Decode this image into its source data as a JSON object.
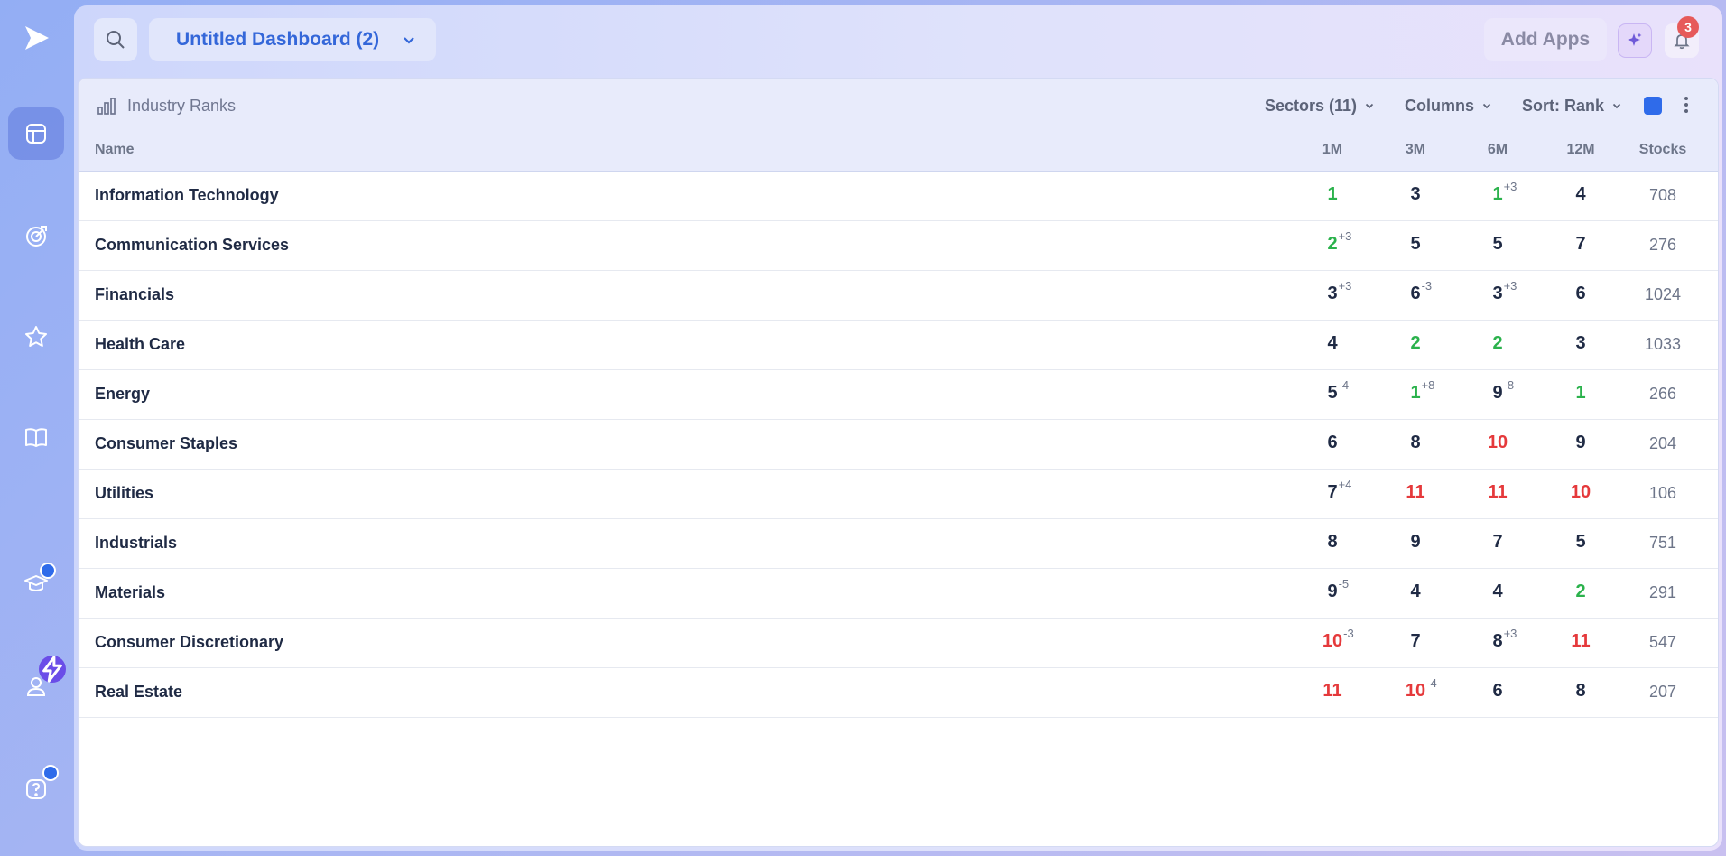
{
  "topbar": {
    "dashboard_title": "Untitled Dashboard (2)",
    "add_apps_label": "Add Apps",
    "notification_count": "3"
  },
  "widget": {
    "title": "Industry Ranks",
    "sectors_label": "Sectors (11)",
    "columns_label": "Columns",
    "sort_label": "Sort: Rank",
    "color_swatch": "#2f6bea"
  },
  "table": {
    "headers": {
      "name": "Name",
      "m1": "1M",
      "m3": "3M",
      "m6": "6M",
      "m12": "12M",
      "stocks": "Stocks"
    },
    "rows": [
      {
        "name": "Information Technology",
        "m1": {
          "v": "1",
          "d": "",
          "c": "green"
        },
        "m3": {
          "v": "3",
          "d": "",
          "c": ""
        },
        "m6": {
          "v": "1",
          "d": "+3",
          "c": "green"
        },
        "m12": {
          "v": "4",
          "d": "",
          "c": ""
        },
        "stocks": "708"
      },
      {
        "name": "Communication Services",
        "m1": {
          "v": "2",
          "d": "+3",
          "c": "green"
        },
        "m3": {
          "v": "5",
          "d": "",
          "c": ""
        },
        "m6": {
          "v": "5",
          "d": "",
          "c": ""
        },
        "m12": {
          "v": "7",
          "d": "",
          "c": ""
        },
        "stocks": "276"
      },
      {
        "name": "Financials",
        "m1": {
          "v": "3",
          "d": "+3",
          "c": ""
        },
        "m3": {
          "v": "6",
          "d": "-3",
          "c": ""
        },
        "m6": {
          "v": "3",
          "d": "+3",
          "c": ""
        },
        "m12": {
          "v": "6",
          "d": "",
          "c": ""
        },
        "stocks": "1024"
      },
      {
        "name": "Health Care",
        "m1": {
          "v": "4",
          "d": "",
          "c": ""
        },
        "m3": {
          "v": "2",
          "d": "",
          "c": "green"
        },
        "m6": {
          "v": "2",
          "d": "",
          "c": "green"
        },
        "m12": {
          "v": "3",
          "d": "",
          "c": ""
        },
        "stocks": "1033"
      },
      {
        "name": "Energy",
        "m1": {
          "v": "5",
          "d": "-4",
          "c": ""
        },
        "m3": {
          "v": "1",
          "d": "+8",
          "c": "green"
        },
        "m6": {
          "v": "9",
          "d": "-8",
          "c": ""
        },
        "m12": {
          "v": "1",
          "d": "",
          "c": "green"
        },
        "stocks": "266"
      },
      {
        "name": "Consumer Staples",
        "m1": {
          "v": "6",
          "d": "",
          "c": ""
        },
        "m3": {
          "v": "8",
          "d": "",
          "c": ""
        },
        "m6": {
          "v": "10",
          "d": "",
          "c": "red"
        },
        "m12": {
          "v": "9",
          "d": "",
          "c": ""
        },
        "stocks": "204"
      },
      {
        "name": "Utilities",
        "m1": {
          "v": "7",
          "d": "+4",
          "c": ""
        },
        "m3": {
          "v": "11",
          "d": "",
          "c": "red"
        },
        "m6": {
          "v": "11",
          "d": "",
          "c": "red"
        },
        "m12": {
          "v": "10",
          "d": "",
          "c": "red"
        },
        "stocks": "106"
      },
      {
        "name": "Industrials",
        "m1": {
          "v": "8",
          "d": "",
          "c": ""
        },
        "m3": {
          "v": "9",
          "d": "",
          "c": ""
        },
        "m6": {
          "v": "7",
          "d": "",
          "c": ""
        },
        "m12": {
          "v": "5",
          "d": "",
          "c": ""
        },
        "stocks": "751"
      },
      {
        "name": "Materials",
        "m1": {
          "v": "9",
          "d": "-5",
          "c": ""
        },
        "m3": {
          "v": "4",
          "d": "",
          "c": ""
        },
        "m6": {
          "v": "4",
          "d": "",
          "c": ""
        },
        "m12": {
          "v": "2",
          "d": "",
          "c": "green"
        },
        "stocks": "291"
      },
      {
        "name": "Consumer Discretionary",
        "m1": {
          "v": "10",
          "d": "-3",
          "c": "red"
        },
        "m3": {
          "v": "7",
          "d": "",
          "c": ""
        },
        "m6": {
          "v": "8",
          "d": "+3",
          "c": ""
        },
        "m12": {
          "v": "11",
          "d": "",
          "c": "red"
        },
        "stocks": "547"
      },
      {
        "name": "Real Estate",
        "m1": {
          "v": "11",
          "d": "",
          "c": "red"
        },
        "m3": {
          "v": "10",
          "d": "-4",
          "c": "red"
        },
        "m6": {
          "v": "6",
          "d": "",
          "c": ""
        },
        "m12": {
          "v": "8",
          "d": "",
          "c": ""
        },
        "stocks": "207"
      }
    ]
  },
  "colors": {
    "green": "#2bb24c",
    "red": "#e5393b",
    "accent": "#3467d9"
  },
  "icons": {
    "sidebar": [
      "logo-icon",
      "dashboard-icon",
      "radar-icon",
      "star-icon",
      "book-icon",
      "graduation-cap-icon",
      "user-icon",
      "help-icon"
    ]
  }
}
